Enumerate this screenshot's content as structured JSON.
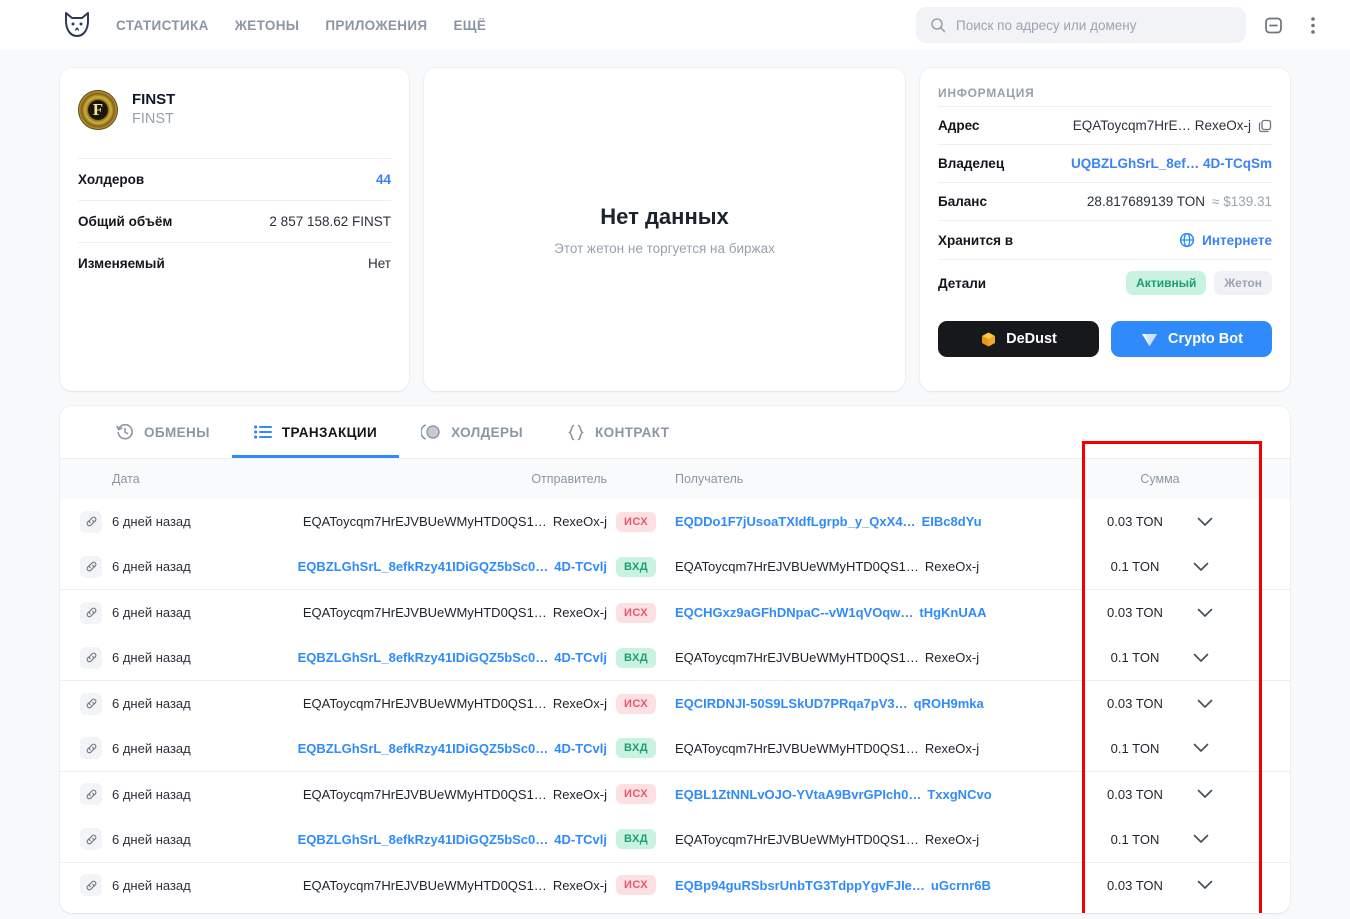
{
  "header": {
    "logo_icon": "cat-logo-icon",
    "nav": [
      {
        "label": "СТАТИСТИКА",
        "name": "nav-statistics"
      },
      {
        "label": "ЖЕТОНЫ",
        "name": "nav-jettons"
      },
      {
        "label": "ПРИЛОЖЕНИЯ",
        "name": "nav-apps"
      },
      {
        "label": "ЕЩЁ",
        "name": "nav-more"
      }
    ],
    "search": {
      "placeholder": "Поиск по адресу или домену",
      "icon": "search-icon",
      "value": ""
    },
    "theme_icon": "theme-toggle-icon",
    "menu_icon": "kebab-menu-icon"
  },
  "token": {
    "logo_letter": "F",
    "name": "FINST",
    "symbol": "FINST",
    "rows": [
      {
        "key": "Холдеров",
        "value": "44",
        "link": true
      },
      {
        "key": "Общий объём",
        "value": "2 857 158.62 FINST",
        "link": false
      },
      {
        "key": "Изменяемый",
        "value": "Нет",
        "link": false
      }
    ]
  },
  "chart": {
    "title": "Нет данных",
    "subtitle": "Этот жетон не торгуется на биржах"
  },
  "info": {
    "title": "ИНФОРМАЦИЯ",
    "address": {
      "key": "Адрес",
      "value": "EQAToycqm7HrE… RexeOx-j",
      "copy_icon": "copy-icon"
    },
    "owner": {
      "key": "Владелец",
      "value": "UQBZLGhSrL_8ef… 4D-TCqSm"
    },
    "balance": {
      "key": "Баланс",
      "value": "28.817689139 TON",
      "usd": "≈ $139.31"
    },
    "stored": {
      "key": "Хранится в",
      "value": "Интернете",
      "icon": "globe-icon"
    },
    "details": {
      "key": "Детали",
      "badge_active": "Активный",
      "badge_type": "Жетон"
    },
    "buttons": [
      {
        "label": "DeDust",
        "icon": "dedust-cube-icon",
        "style": "dark"
      },
      {
        "label": "Crypto Bot",
        "icon": "crypto-bot-icon",
        "style": "blue"
      }
    ]
  },
  "tabs": [
    {
      "label": "ОБМЕНЫ",
      "icon": "history-clock-icon",
      "active": false,
      "name": "tab-swaps"
    },
    {
      "label": "ТРАНЗАКЦИИ",
      "icon": "list-icon",
      "active": true,
      "name": "tab-transactions"
    },
    {
      "label": "ХОЛДЕРЫ",
      "icon": "pie-chart-icon",
      "active": false,
      "name": "tab-holders"
    },
    {
      "label": "КОНТРАКТ",
      "icon": "braces-icon",
      "active": false,
      "name": "tab-contract"
    }
  ],
  "table": {
    "columns": [
      "",
      "Дата",
      "Отправитель",
      "",
      "Получатель",
      "Сумма"
    ],
    "rows": [
      {
        "date": "6 дней назад",
        "from_main": "EQAToycqm7HrEJVBUeWMyHTD0QS1…",
        "from_tail": "RexeOx-j",
        "from_link": false,
        "dir": "ИСХ",
        "dir_type": "out",
        "to_main": "EQDDo1F7jUsoaTXIdfLgrpb_y_QxX4…",
        "to_tail": "EIBc8dYu",
        "to_link": true,
        "amount": "0.03 TON",
        "group_start": true
      },
      {
        "date": "6 дней назад",
        "from_main": "EQBZLGhSrL_8efkRzy41IDiGQZ5bSc0…",
        "from_tail": "4D-TCvlj",
        "from_link": true,
        "dir": "ВХД",
        "dir_type": "in",
        "to_main": "EQAToycqm7HrEJVBUeWMyHTD0QS1…",
        "to_tail": "RexeOx-j",
        "to_link": false,
        "amount": "0.1 TON",
        "group_start": false
      },
      {
        "date": "6 дней назад",
        "from_main": "EQAToycqm7HrEJVBUeWMyHTD0QS1…",
        "from_tail": "RexeOx-j",
        "from_link": false,
        "dir": "ИСХ",
        "dir_type": "out",
        "to_main": "EQCHGxz9aGFhDNpaC--vW1qVOqw…",
        "to_tail": "tHgKnUAA",
        "to_link": true,
        "amount": "0.03 TON",
        "group_start": true
      },
      {
        "date": "6 дней назад",
        "from_main": "EQBZLGhSrL_8efkRzy41IDiGQZ5bSc0…",
        "from_tail": "4D-TCvlj",
        "from_link": true,
        "dir": "ВХД",
        "dir_type": "in",
        "to_main": "EQAToycqm7HrEJVBUeWMyHTD0QS1…",
        "to_tail": "RexeOx-j",
        "to_link": false,
        "amount": "0.1 TON",
        "group_start": false
      },
      {
        "date": "6 дней назад",
        "from_main": "EQAToycqm7HrEJVBUeWMyHTD0QS1…",
        "from_tail": "RexeOx-j",
        "from_link": false,
        "dir": "ИСХ",
        "dir_type": "out",
        "to_main": "EQCIRDNJI-50S9LSkUD7PRqa7pV3…",
        "to_tail": "qROH9mka",
        "to_link": true,
        "amount": "0.03 TON",
        "group_start": true
      },
      {
        "date": "6 дней назад",
        "from_main": "EQBZLGhSrL_8efkRzy41IDiGQZ5bSc0…",
        "from_tail": "4D-TCvlj",
        "from_link": true,
        "dir": "ВХД",
        "dir_type": "in",
        "to_main": "EQAToycqm7HrEJVBUeWMyHTD0QS1…",
        "to_tail": "RexeOx-j",
        "to_link": false,
        "amount": "0.1 TON",
        "group_start": false
      },
      {
        "date": "6 дней назад",
        "from_main": "EQAToycqm7HrEJVBUeWMyHTD0QS1…",
        "from_tail": "RexeOx-j",
        "from_link": false,
        "dir": "ИСХ",
        "dir_type": "out",
        "to_main": "EQBL1ZtNNLvOJO-YVtaA9BvrGPIch0…",
        "to_tail": "TxxgNCvo",
        "to_link": true,
        "amount": "0.03 TON",
        "group_start": true
      },
      {
        "date": "6 дней назад",
        "from_main": "EQBZLGhSrL_8efkRzy41IDiGQZ5bSc0…",
        "from_tail": "4D-TCvlj",
        "from_link": true,
        "dir": "ВХД",
        "dir_type": "in",
        "to_main": "EQAToycqm7HrEJVBUeWMyHTD0QS1…",
        "to_tail": "RexeOx-j",
        "to_link": false,
        "amount": "0.1 TON",
        "group_start": false
      },
      {
        "date": "6 дней назад",
        "from_main": "EQAToycqm7HrEJVBUeWMyHTD0QS1…",
        "from_tail": "RexeOx-j",
        "from_link": false,
        "dir": "ИСХ",
        "dir_type": "out",
        "to_main": "EQBp94guRSbsrUnbTG3TdppYgvFJIe…",
        "to_tail": "uGcrnr6B",
        "to_link": true,
        "amount": "0.03 TON",
        "group_start": true
      }
    ]
  },
  "annotation": {
    "type": "highlight-rectangle",
    "color": "#f40000",
    "target": "amount-column"
  },
  "colors": {
    "accent": "#2f8bfb",
    "link": "#2f8bfb",
    "positive": "#1f9e72",
    "negative": "#e8566c",
    "highlight": "#f40000"
  }
}
